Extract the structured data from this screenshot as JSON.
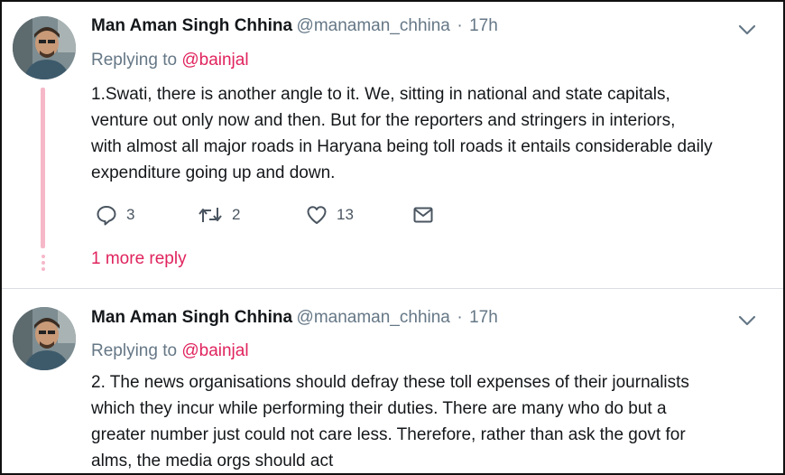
{
  "tweets": [
    {
      "author_name": "Man Aman Singh Chhina",
      "handle": "@manaman_chhina",
      "separator": "·",
      "time": "17h",
      "replying_prefix": "Replying to",
      "replying_to": "@bainjal",
      "text_lines": [
        "1.Swati, there is another angle to it. We, sitting in national and state capitals,",
        "venture out only now and then. But for the reporters and stringers in interiors,",
        "with almost all major roads in Haryana being toll roads it entails considerable daily",
        "expenditure going up and down."
      ],
      "reply_count": "3",
      "retweet_count": "2",
      "like_count": "13",
      "more_replies": "1 more reply"
    },
    {
      "author_name": "Man Aman Singh Chhina",
      "handle": "@manaman_chhina",
      "separator": "·",
      "time": "17h",
      "replying_prefix": "Replying to",
      "replying_to": "@bainjal",
      "text_lines": [
        "2. The news organisations should defray these toll expenses of their journalists",
        "which they incur while performing their duties. There are many who do but a",
        "greater number just could not care less. Therefore, rather than ask the govt for",
        "alms, the media orgs should act"
      ]
    }
  ],
  "icons": {
    "reply": "reply-icon",
    "retweet": "retweet-icon",
    "like": "heart-icon",
    "dm": "envelope-icon",
    "caret": "chevron-down-icon"
  },
  "colors": {
    "accent_pink": "#e0245e",
    "thread_line": "#f6b8c9",
    "secondary_text": "#657786",
    "primary_text": "#14171a"
  }
}
